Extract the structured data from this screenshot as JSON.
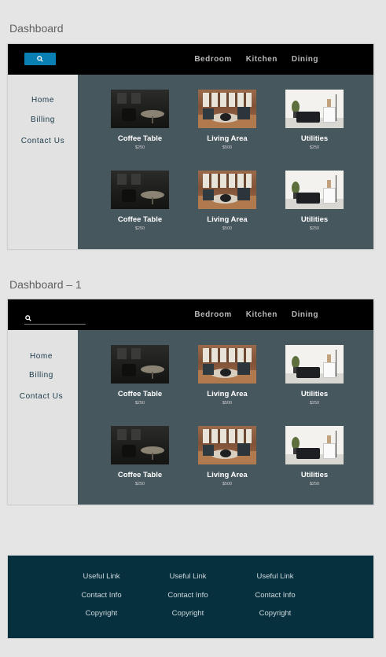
{
  "artboards": [
    {
      "title": "Dashboard",
      "search_variant": "button"
    },
    {
      "title": "Dashboard – 1",
      "search_variant": "underline"
    }
  ],
  "nav": [
    "Bedroom",
    "Kitchen",
    "Dining"
  ],
  "sidebar": [
    "Home",
    "Billing",
    "Contact Us"
  ],
  "products": [
    {
      "title": "Coffee Table",
      "price": "$250",
      "image": "coffee-table-photo"
    },
    {
      "title": "Living Area",
      "price": "$500",
      "image": "living-area-photo"
    },
    {
      "title": "Utilities",
      "price": "$250",
      "image": "utilities-photo"
    },
    {
      "title": "Coffee Table",
      "price": "$250",
      "image": "coffee-table-photo"
    },
    {
      "title": "Living Area",
      "price": "$500",
      "image": "living-area-photo"
    },
    {
      "title": "Utilities",
      "price": "$250",
      "image": "utilities-photo"
    }
  ],
  "footer": {
    "columns": [
      [
        "Useful Link",
        "Contact Info",
        "Copyright"
      ],
      [
        "Useful Link",
        "Contact Info",
        "Copyright"
      ],
      [
        "Useful Link",
        "Contact Info",
        "Copyright"
      ]
    ]
  },
  "icons": {
    "search": "search-icon"
  },
  "colors": {
    "canvas": "#e5e5e5",
    "topbar": "#000000",
    "search_button": "#0a7fb3",
    "sidebar": "#e2e2e2",
    "sidebar_text": "#1a3a4a",
    "main": "#47575e",
    "footer": "#07303f"
  }
}
